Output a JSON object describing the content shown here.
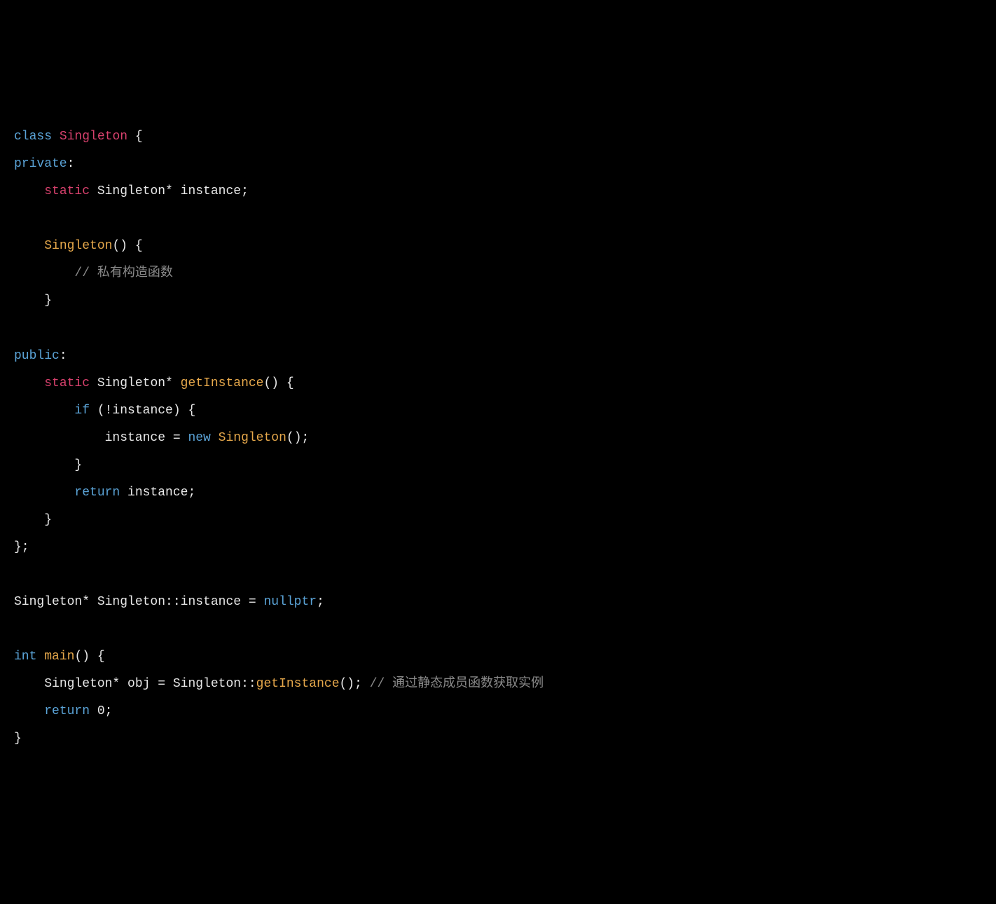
{
  "code": {
    "line1": {
      "kw_class": "class",
      "class_name": "Singleton",
      "brace": " {"
    },
    "line2": {
      "access": "private",
      "colon": ":"
    },
    "line3": {
      "kw_static": "static",
      "decl": " Singleton* instance;"
    },
    "line4": {
      "ctor": "Singleton",
      "after": "() {"
    },
    "line5": {
      "comment": "// 私有构造函数"
    },
    "line6": {
      "brace": "}"
    },
    "line7": {
      "access": "public",
      "colon": ":"
    },
    "line8": {
      "kw_static": "static",
      "ret": " Singleton* ",
      "fn": "getInstance",
      "after": "() {"
    },
    "line9": {
      "kw_if": "if",
      "cond": " (!instance) {"
    },
    "line10": {
      "lhs": "instance = ",
      "kw_new": "new",
      "sp": " ",
      "cls": "Singleton",
      "after": "();"
    },
    "line11": {
      "brace": "}"
    },
    "line12": {
      "kw_return": "return",
      "expr": " instance;"
    },
    "line13": {
      "brace": "}"
    },
    "line14": {
      "brace": "};"
    },
    "line15": {
      "decl": "Singleton* Singleton::instance = ",
      "nullptr": "nullptr",
      "semi": ";"
    },
    "line16": {
      "kw_int": "int",
      "sp": " ",
      "fn": "main",
      "after": "() {"
    },
    "line17": {
      "decl": "Singleton* obj = Singleton::",
      "fn": "getInstance",
      "call": "(); ",
      "comment": "// 通过静态成员函数获取实例"
    },
    "line18": {
      "kw_return": "return",
      "val": " 0;"
    },
    "line19": {
      "brace": "}"
    }
  }
}
